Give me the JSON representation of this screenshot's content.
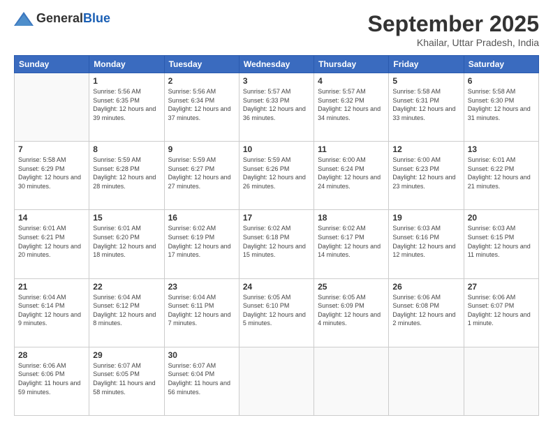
{
  "header": {
    "logo_general": "General",
    "logo_blue": "Blue",
    "title": "September 2025",
    "location": "Khailar, Uttar Pradesh, India"
  },
  "days_of_week": [
    "Sunday",
    "Monday",
    "Tuesday",
    "Wednesday",
    "Thursday",
    "Friday",
    "Saturday"
  ],
  "weeks": [
    [
      {
        "day": "",
        "sunrise": "",
        "sunset": "",
        "daylight": ""
      },
      {
        "day": "1",
        "sunrise": "Sunrise: 5:56 AM",
        "sunset": "Sunset: 6:35 PM",
        "daylight": "Daylight: 12 hours and 39 minutes."
      },
      {
        "day": "2",
        "sunrise": "Sunrise: 5:56 AM",
        "sunset": "Sunset: 6:34 PM",
        "daylight": "Daylight: 12 hours and 37 minutes."
      },
      {
        "day": "3",
        "sunrise": "Sunrise: 5:57 AM",
        "sunset": "Sunset: 6:33 PM",
        "daylight": "Daylight: 12 hours and 36 minutes."
      },
      {
        "day": "4",
        "sunrise": "Sunrise: 5:57 AM",
        "sunset": "Sunset: 6:32 PM",
        "daylight": "Daylight: 12 hours and 34 minutes."
      },
      {
        "day": "5",
        "sunrise": "Sunrise: 5:58 AM",
        "sunset": "Sunset: 6:31 PM",
        "daylight": "Daylight: 12 hours and 33 minutes."
      },
      {
        "day": "6",
        "sunrise": "Sunrise: 5:58 AM",
        "sunset": "Sunset: 6:30 PM",
        "daylight": "Daylight: 12 hours and 31 minutes."
      }
    ],
    [
      {
        "day": "7",
        "sunrise": "Sunrise: 5:58 AM",
        "sunset": "Sunset: 6:29 PM",
        "daylight": "Daylight: 12 hours and 30 minutes."
      },
      {
        "day": "8",
        "sunrise": "Sunrise: 5:59 AM",
        "sunset": "Sunset: 6:28 PM",
        "daylight": "Daylight: 12 hours and 28 minutes."
      },
      {
        "day": "9",
        "sunrise": "Sunrise: 5:59 AM",
        "sunset": "Sunset: 6:27 PM",
        "daylight": "Daylight: 12 hours and 27 minutes."
      },
      {
        "day": "10",
        "sunrise": "Sunrise: 5:59 AM",
        "sunset": "Sunset: 6:26 PM",
        "daylight": "Daylight: 12 hours and 26 minutes."
      },
      {
        "day": "11",
        "sunrise": "Sunrise: 6:00 AM",
        "sunset": "Sunset: 6:24 PM",
        "daylight": "Daylight: 12 hours and 24 minutes."
      },
      {
        "day": "12",
        "sunrise": "Sunrise: 6:00 AM",
        "sunset": "Sunset: 6:23 PM",
        "daylight": "Daylight: 12 hours and 23 minutes."
      },
      {
        "day": "13",
        "sunrise": "Sunrise: 6:01 AM",
        "sunset": "Sunset: 6:22 PM",
        "daylight": "Daylight: 12 hours and 21 minutes."
      }
    ],
    [
      {
        "day": "14",
        "sunrise": "Sunrise: 6:01 AM",
        "sunset": "Sunset: 6:21 PM",
        "daylight": "Daylight: 12 hours and 20 minutes."
      },
      {
        "day": "15",
        "sunrise": "Sunrise: 6:01 AM",
        "sunset": "Sunset: 6:20 PM",
        "daylight": "Daylight: 12 hours and 18 minutes."
      },
      {
        "day": "16",
        "sunrise": "Sunrise: 6:02 AM",
        "sunset": "Sunset: 6:19 PM",
        "daylight": "Daylight: 12 hours and 17 minutes."
      },
      {
        "day": "17",
        "sunrise": "Sunrise: 6:02 AM",
        "sunset": "Sunset: 6:18 PM",
        "daylight": "Daylight: 12 hours and 15 minutes."
      },
      {
        "day": "18",
        "sunrise": "Sunrise: 6:02 AM",
        "sunset": "Sunset: 6:17 PM",
        "daylight": "Daylight: 12 hours and 14 minutes."
      },
      {
        "day": "19",
        "sunrise": "Sunrise: 6:03 AM",
        "sunset": "Sunset: 6:16 PM",
        "daylight": "Daylight: 12 hours and 12 minutes."
      },
      {
        "day": "20",
        "sunrise": "Sunrise: 6:03 AM",
        "sunset": "Sunset: 6:15 PM",
        "daylight": "Daylight: 12 hours and 11 minutes."
      }
    ],
    [
      {
        "day": "21",
        "sunrise": "Sunrise: 6:04 AM",
        "sunset": "Sunset: 6:14 PM",
        "daylight": "Daylight: 12 hours and 9 minutes."
      },
      {
        "day": "22",
        "sunrise": "Sunrise: 6:04 AM",
        "sunset": "Sunset: 6:12 PM",
        "daylight": "Daylight: 12 hours and 8 minutes."
      },
      {
        "day": "23",
        "sunrise": "Sunrise: 6:04 AM",
        "sunset": "Sunset: 6:11 PM",
        "daylight": "Daylight: 12 hours and 7 minutes."
      },
      {
        "day": "24",
        "sunrise": "Sunrise: 6:05 AM",
        "sunset": "Sunset: 6:10 PM",
        "daylight": "Daylight: 12 hours and 5 minutes."
      },
      {
        "day": "25",
        "sunrise": "Sunrise: 6:05 AM",
        "sunset": "Sunset: 6:09 PM",
        "daylight": "Daylight: 12 hours and 4 minutes."
      },
      {
        "day": "26",
        "sunrise": "Sunrise: 6:06 AM",
        "sunset": "Sunset: 6:08 PM",
        "daylight": "Daylight: 12 hours and 2 minutes."
      },
      {
        "day": "27",
        "sunrise": "Sunrise: 6:06 AM",
        "sunset": "Sunset: 6:07 PM",
        "daylight": "Daylight: 12 hours and 1 minute."
      }
    ],
    [
      {
        "day": "28",
        "sunrise": "Sunrise: 6:06 AM",
        "sunset": "Sunset: 6:06 PM",
        "daylight": "Daylight: 11 hours and 59 minutes."
      },
      {
        "day": "29",
        "sunrise": "Sunrise: 6:07 AM",
        "sunset": "Sunset: 6:05 PM",
        "daylight": "Daylight: 11 hours and 58 minutes."
      },
      {
        "day": "30",
        "sunrise": "Sunrise: 6:07 AM",
        "sunset": "Sunset: 6:04 PM",
        "daylight": "Daylight: 11 hours and 56 minutes."
      },
      {
        "day": "",
        "sunrise": "",
        "sunset": "",
        "daylight": ""
      },
      {
        "day": "",
        "sunrise": "",
        "sunset": "",
        "daylight": ""
      },
      {
        "day": "",
        "sunrise": "",
        "sunset": "",
        "daylight": ""
      },
      {
        "day": "",
        "sunrise": "",
        "sunset": "",
        "daylight": ""
      }
    ]
  ]
}
